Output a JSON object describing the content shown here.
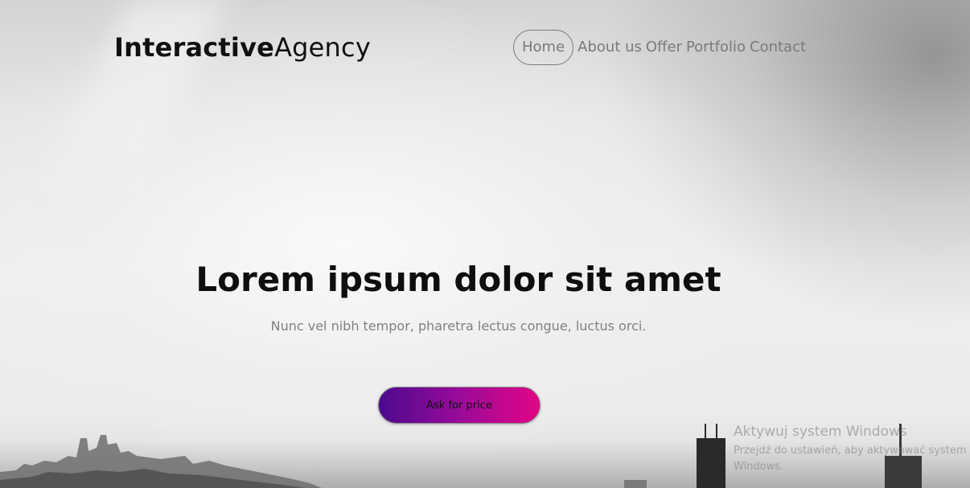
{
  "brand": {
    "name_bold": "Interactive",
    "name_light": "Agency"
  },
  "nav": {
    "items": [
      {
        "label": "Home",
        "active": true
      },
      {
        "label": "About us",
        "active": false
      },
      {
        "label": "Offer",
        "active": false
      },
      {
        "label": "Portfolio",
        "active": false
      },
      {
        "label": "Contact",
        "active": false
      }
    ]
  },
  "hero": {
    "headline": "Lorem ipsum dolor sit amet",
    "subline": "Nunc vel nibh tempor, pharetra lectus congue, luctus orci.",
    "cta_label": "Ask for price",
    "cta_gradient": [
      "#4a0a8e",
      "#e20585"
    ]
  },
  "watermark": {
    "title": "Aktywuj system Windows",
    "body": "Przejdź do ustawień, aby aktywować system Windows."
  }
}
